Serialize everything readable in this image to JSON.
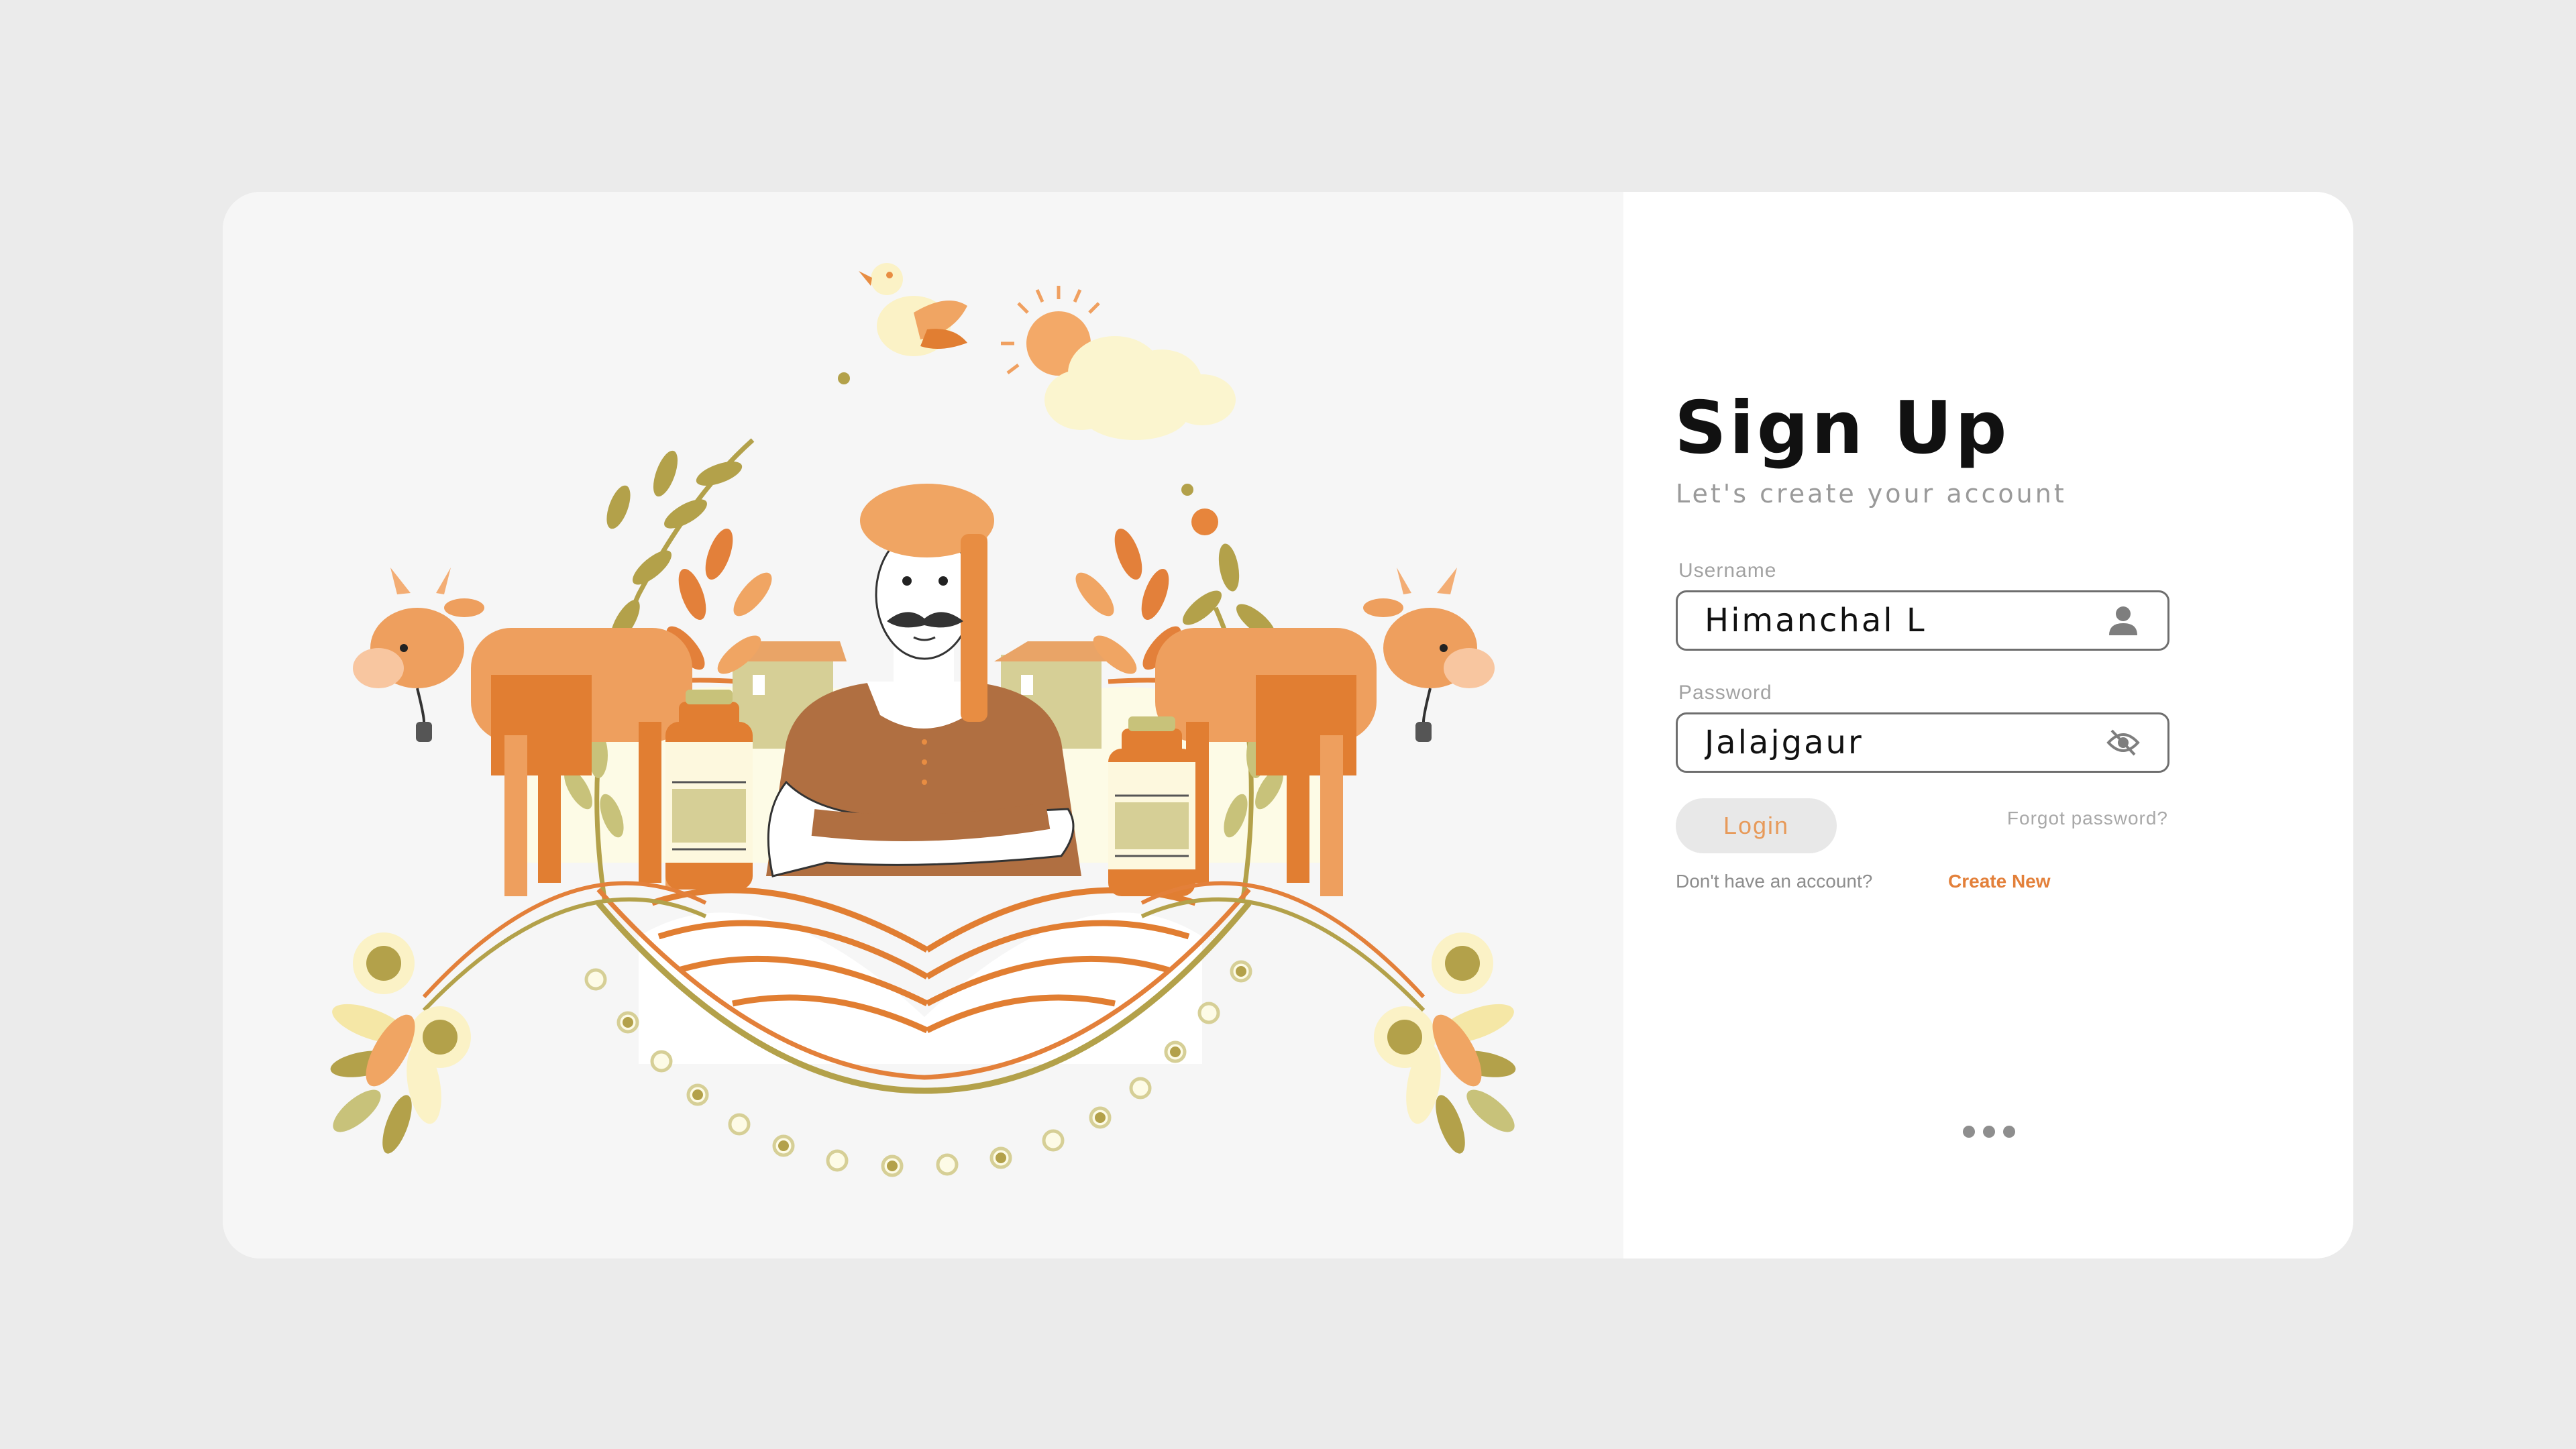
{
  "signup": {
    "title": "Sign Up",
    "subtitle": "Let's create your account",
    "username_label": "Username",
    "username_value": "Himanchal L",
    "password_label": "Password",
    "password_value": "Jalajgaur",
    "login_label": "Login",
    "forgot_label": "Forgot password?",
    "no_account_text": "Don't have an account?",
    "create_new_label": "Create New"
  },
  "icons": {
    "username": "user-icon",
    "password": "eye-off-icon",
    "more": "more-dots-icon"
  },
  "colors": {
    "accent_orange": "#e3803a",
    "cow": "#ee9f5e",
    "olive": "#b3a14a",
    "card_left_bg": "#f6f6f6",
    "page_bg": "#ebebeb"
  }
}
